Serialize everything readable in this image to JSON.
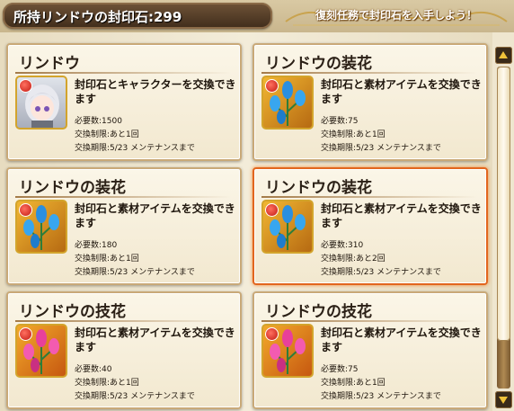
{
  "header": {
    "title": "所持リンドウの封印石:299",
    "mission": "復刻任務で封印石を入手しよう！"
  },
  "cards": [
    {
      "title": "リンドウ",
      "thumb": "character-portrait",
      "desc": "封印石とキャラクターを交換できます",
      "cost": "必要数:1500",
      "limit": "交換制限:あと1回",
      "period": "交換期限:5/23 メンテナンスまで"
    },
    {
      "title": "リンドウの装花",
      "thumb": "blue-gentian-flower",
      "desc": "封印石と素材アイテムを交換できます",
      "cost": "必要数:75",
      "limit": "交換制限:あと1回",
      "period": "交換期限:5/23 メンテナンスまで"
    },
    {
      "title": "リンドウの装花",
      "thumb": "blue-gentian-flower",
      "desc": "封印石と素材アイテムを交換できます",
      "cost": "必要数:180",
      "limit": "交換制限:あと1回",
      "period": "交換期限:5/23 メンテナンスまで"
    },
    {
      "title": "リンドウの装花",
      "thumb": "blue-gentian-flower",
      "desc": "封印石と素材アイテムを交換できます",
      "cost": "必要数:310",
      "limit": "交換制限:あと2回",
      "period": "交換期限:5/23 メンテナンスまで",
      "selected": true
    },
    {
      "title": "リンドウの技花",
      "thumb": "pink-gentian-flower",
      "desc": "封印石と素材アイテムを交換できます",
      "cost": "必要数:40",
      "limit": "交換制限:あと1回",
      "period": "交換期限:5/23 メンテナンスまで"
    },
    {
      "title": "リンドウの技花",
      "thumb": "pink-gentian-flower",
      "desc": "封印石と素材アイテムを交換できます",
      "cost": "必要数:75",
      "limit": "交換制限:あと1回",
      "period": "交換期限:5/23 メンテナンスまで"
    }
  ],
  "colors": {
    "selected_border": "#e2661e",
    "accent_gold": "#d3a42c",
    "blue_flower": "#2a8fe0",
    "pink_flower": "#e8409a"
  }
}
